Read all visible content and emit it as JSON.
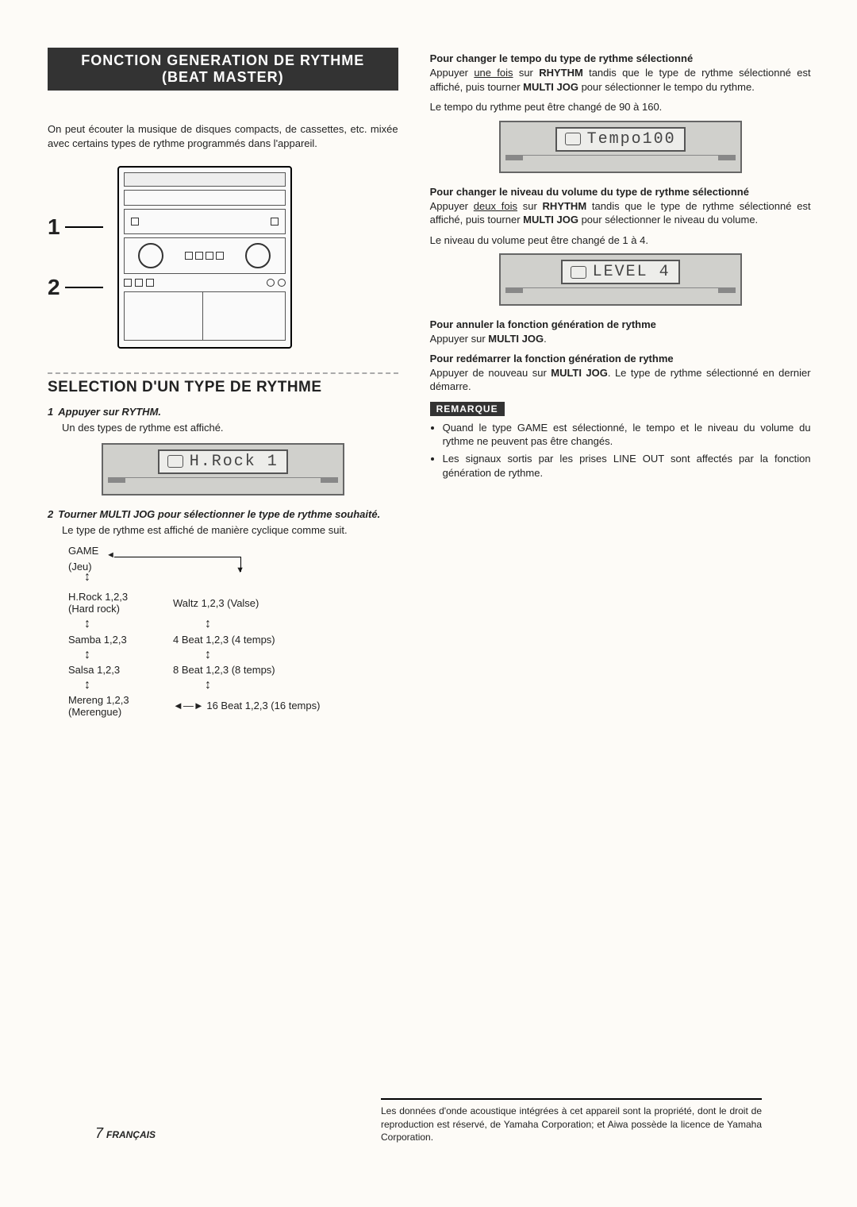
{
  "banner": "FONCTION GENERATION DE RYTHME (BEAT MASTER)",
  "intro": "On peut écouter la musique de disques compacts, de cassettes, etc. mixée avec certains types de rythme programmés dans l'appareil.",
  "callouts": {
    "one": "1",
    "two": "2"
  },
  "section_title": "SELECTION D'UN TYPE DE RYTHME",
  "step1": {
    "num": "1",
    "head": "Appuyer sur RYTHM.",
    "body": "Un des types de rythme est affiché.",
    "lcd": "H.Rock 1"
  },
  "step2": {
    "num": "2",
    "head": "Tourner MULTI JOG pour sélectionner le type de rythme souhaité.",
    "body": "Le type de rythme est affiché de manière cyclique comme suit."
  },
  "cycle": {
    "game": "GAME",
    "game_sub": "(Jeu)",
    "hrock": "H.Rock 1,2,3",
    "hrock_sub": "(Hard rock)",
    "waltz": "Waltz 1,2,3 (Valse)",
    "samba": "Samba 1,2,3",
    "beat4": "4 Beat 1,2,3 (4 temps)",
    "salsa": "Salsa 1,2,3",
    "beat8": "8 Beat 1,2,3 (8 temps)",
    "mereng": "Mereng 1,2,3",
    "mereng_sub": "(Merengue)",
    "beat16": "16 Beat 1,2,3 (16 temps)",
    "hconn": "◄—►"
  },
  "tempo": {
    "head": "Pour changer le tempo du type de rythme sélectionné",
    "p1a": "Appuyer ",
    "p1u": "une fois",
    "p1b": " sur ",
    "p1bold1": "RHYTHM",
    "p1c": " tandis que le type de rythme sélectionné est affiché, puis tourner ",
    "p1bold2": "MULTI JOG",
    "p1d": " pour sélectionner le tempo du rythme.",
    "p2": "Le tempo du rythme peut être changé de 90 à 160.",
    "lcd": "Tempo100"
  },
  "volume": {
    "head": "Pour changer le niveau du volume du type de rythme sélectionné",
    "p1a": "Appuyer ",
    "p1u": "deux fois",
    "p1b": " sur ",
    "p1bold1": "RHYTHM",
    "p1c": " tandis que le type de rythme sélectionné est affiché, puis tourner ",
    "p1bold2": "MULTI JOG",
    "p1d": " pour sélectionner le niveau du volume.",
    "p2": "Le niveau du volume peut être changé de 1 à 4.",
    "lcd": "LEVEL  4"
  },
  "cancel": {
    "head": "Pour annuler la fonction génération de rythme",
    "body_a": "Appuyer sur ",
    "body_bold": "MULTI JOG",
    "body_b": "."
  },
  "restart": {
    "head": "Pour redémarrer la fonction génération de rythme",
    "body_a": "Appuyer de nouveau sur ",
    "body_bold": "MULTI JOG",
    "body_b": ". Le type de rythme sélectionné en dernier démarre."
  },
  "remark": {
    "tag": "REMARQUE",
    "li1": "Quand le type GAME est sélectionné, le tempo et le niveau du volume du rythme ne peuvent pas être changés.",
    "li2": "Les signaux sortis par les prises LINE OUT sont affectés par la fonction génération de rythme."
  },
  "footnote": "Les données d'onde acoustique intégrées à cet appareil sont la propriété, dont le droit de reproduction est réservé, de Yamaha Corporation; et Aiwa possède la licence de Yamaha Corporation.",
  "page": {
    "num": "7",
    "lang": "FRANÇAIS"
  }
}
